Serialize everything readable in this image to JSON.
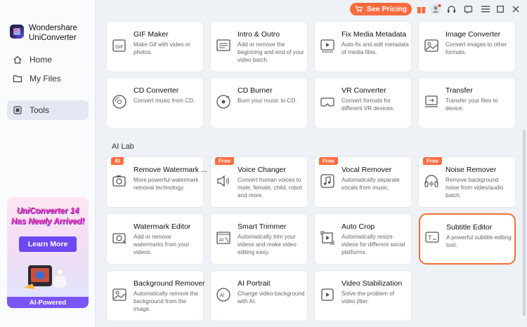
{
  "app": {
    "brand_line1": "Wondershare",
    "brand_line2": "UniConverter"
  },
  "sidebar": {
    "items": [
      {
        "label": "Home",
        "icon": "home-icon"
      },
      {
        "label": "My Files",
        "icon": "folder-icon"
      },
      {
        "label": "Tools",
        "icon": "tools-icon",
        "active": true
      }
    ]
  },
  "promo": {
    "title_line1": "UniConverter 14",
    "title_line2": "Has Newly Arrived!",
    "button": "Learn More",
    "badge": "AI-Powered"
  },
  "titlebar": {
    "pricing_label": "See Pricing",
    "icons": [
      "gift-icon",
      "user-icon",
      "headset-icon",
      "menu-icon",
      "minimize-icon",
      "maximize-icon",
      "close-icon"
    ]
  },
  "colors": {
    "accent_orange": "#ff6b3d",
    "promo_purple": "#6b48f2",
    "highlight_border": "#f07030"
  },
  "section_ai_lab": "AI Lab",
  "tools_top": [
    {
      "title": "GIF Maker",
      "desc": "Make Gif with video or photos.",
      "icon": "gif-icon"
    },
    {
      "title": "Intro & Outro",
      "desc": "Add or remove the beginning and end of your video batch.",
      "icon": "intro-outro-icon"
    },
    {
      "title": "Fix Media Metadata",
      "desc": "Auto-fix and edit metadata of media files.",
      "icon": "metadata-icon"
    },
    {
      "title": "Image Converter",
      "desc": "Convert images to other formats.",
      "icon": "image-icon"
    },
    {
      "title": "CD Converter",
      "desc": "Convert music from CD.",
      "icon": "cd-icon"
    },
    {
      "title": "CD Burner",
      "desc": "Burn your music to CD.",
      "icon": "cd-burner-icon"
    },
    {
      "title": "VR Converter",
      "desc": "Convert formats for different VR devices.",
      "icon": "vr-icon"
    },
    {
      "title": "Transfer",
      "desc": "Transfer your files to device.",
      "icon": "transfer-icon"
    }
  ],
  "tools_ai": [
    {
      "title": "Remove Watermark ...",
      "desc": "More powerful watermark removal technology.",
      "icon": "camera-erase-icon",
      "tag": "AI"
    },
    {
      "title": "Voice Changer",
      "desc": "Convert human voices to male, female, child, robot and more.",
      "icon": "speaker-icon",
      "tag": "Free"
    },
    {
      "title": "Vocal Remover",
      "desc": "Automatically separate vocals from music.",
      "icon": "music-icon",
      "tag": "Free"
    },
    {
      "title": "Noise Remover",
      "desc": "Remove background noise from video/audio batch.",
      "icon": "headphones-icon",
      "tag": "Free"
    },
    {
      "title": "Watermark Editor",
      "desc": "Add or remove watermarks from your videos.",
      "icon": "watermark-icon"
    },
    {
      "title": "Smart Trimmer",
      "desc": "Automatically trim your videos and make video editing easy.",
      "icon": "ai-trim-icon"
    },
    {
      "title": "Auto Crop",
      "desc": "Automatically resize videos for different social platforms.",
      "icon": "crop-icon"
    },
    {
      "title": "Subtitle Editor",
      "desc": "A powerful subtitle editing tool.",
      "icon": "subtitle-icon",
      "highlighted": true
    },
    {
      "title": "Background Remover",
      "desc": "Automatically remove the background from the image.",
      "icon": "bg-remove-icon"
    },
    {
      "title": "AI  Portrait",
      "desc": "Change video background with AI.",
      "icon": "portrait-icon"
    },
    {
      "title": "Video Stabilization",
      "desc": "Solve the problem of video jitter.",
      "icon": "stabilize-icon"
    }
  ]
}
